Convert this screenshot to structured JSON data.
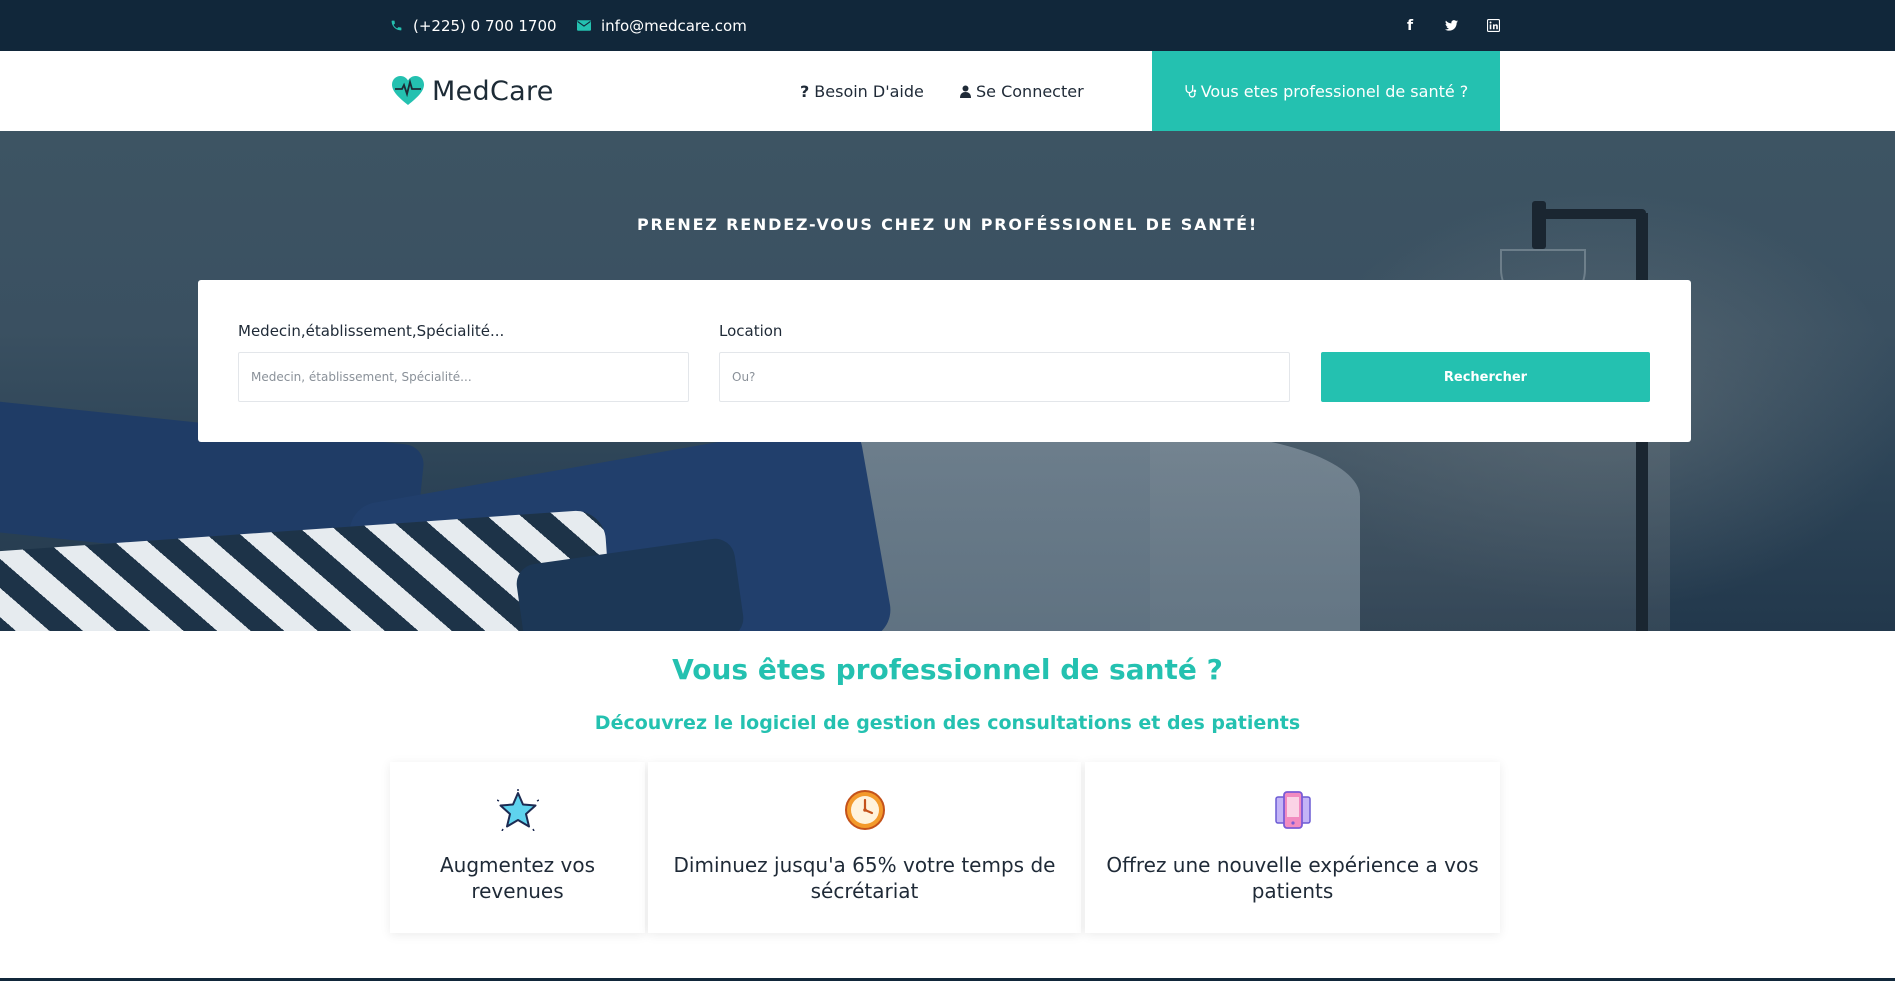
{
  "topbar": {
    "phone": "(+225) 0 700 1700",
    "email": "info@medcare.com",
    "social": [
      {
        "icon": "facebook-icon",
        "glyph": "f"
      },
      {
        "icon": "twitter-icon",
        "glyph": "t"
      },
      {
        "icon": "linkedin-icon",
        "glyph": "in"
      }
    ]
  },
  "header": {
    "brand": "MedCare",
    "nav": {
      "help_icon": "?",
      "help": "Besoin D'aide",
      "login": "Se Connecter",
      "pro_button": "Vous etes professionel de santé ?"
    }
  },
  "hero": {
    "title": "PRENEZ RENDEZ-VOUS CHEZ UN PROFÉSSIONEL DE SANTÉ!",
    "search": {
      "query_label": "Medecin,établissement,Spécialité...",
      "query_placeholder": "Medecin, établissement, Spécialité...",
      "location_label": "Location",
      "location_placeholder": "Ou?",
      "button": "Rechercher"
    }
  },
  "pro_section": {
    "title": "Vous êtes professionnel de santé ?",
    "subtitle": "Découvrez le logiciel de gestion des consultations et des patients",
    "cards": [
      {
        "icon": "star-icon",
        "text": "Augmentez vos revenues"
      },
      {
        "icon": "clock-icon",
        "text": "Diminuez jusqu'a 65% votre temps de sécrétariat"
      },
      {
        "icon": "mobile-devices-icon",
        "text": "Offrez une nouvelle expérience a vos patients"
      }
    ]
  },
  "colors": {
    "accent": "#24c1b0",
    "topbar": "#11273a",
    "text": "#1f2a37"
  }
}
